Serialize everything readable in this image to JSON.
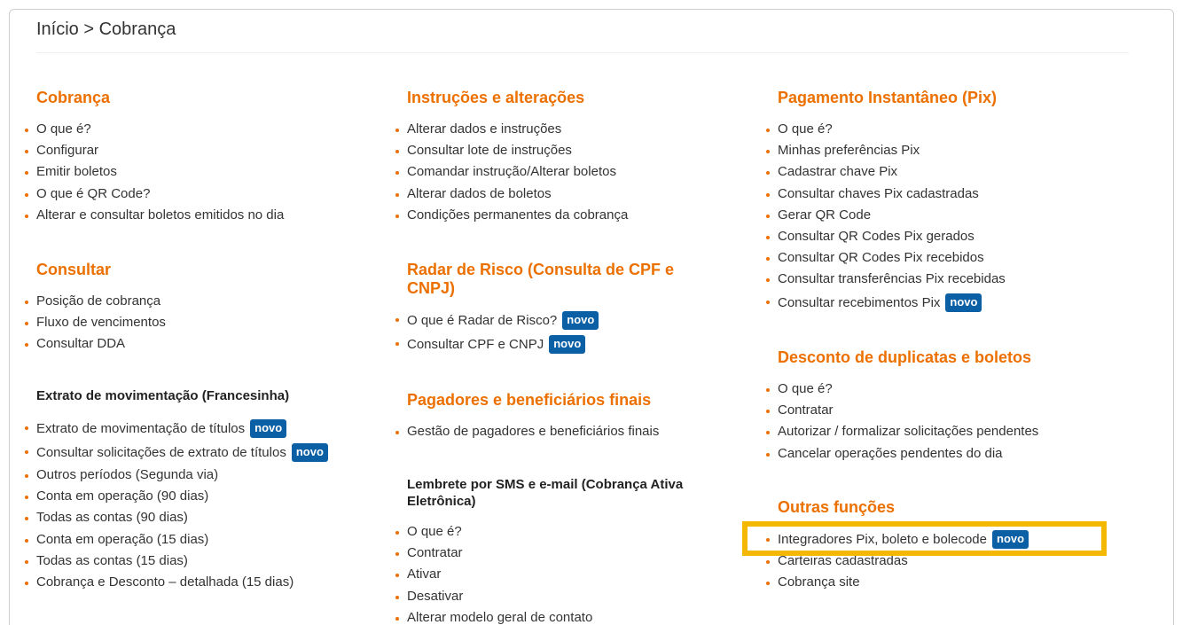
{
  "breadcrumb": "Início > Cobrança",
  "badge_label": "novo",
  "colors": {
    "accent": "#ec7000",
    "badge": "#0b5fa5",
    "highlight": "#f5b800"
  },
  "col1": {
    "cobranca": {
      "title": "Cobrança",
      "items": [
        "O que é?",
        "Configurar",
        "Emitir boletos",
        "O que é QR Code?",
        "Alterar e consultar boletos emitidos no dia"
      ]
    },
    "consultar": {
      "title": "Consultar",
      "items": [
        "Posição de cobrança",
        "Fluxo de vencimentos",
        "Consultar DDA"
      ]
    },
    "extrato": {
      "title": "Extrato de movimentação (Francesinha)",
      "items": [
        "Extrato de movimentação de títulos",
        "Consultar solicitações de extrato de títulos",
        "Outros períodos (Segunda via)",
        "Conta em operação (90 dias)",
        "Todas as contas (90 dias)",
        "Conta em operação (15 dias)",
        "Todas as contas (15 dias)",
        "Cobrança e Desconto – detalhada (15 dias)"
      ]
    }
  },
  "col2": {
    "instrucoes": {
      "title": "Instruções e alterações",
      "items": [
        "Alterar dados e instruções",
        "Consultar lote de instruções",
        "Comandar instrução/Alterar boletos",
        "Alterar dados de boletos",
        "Condições permanentes da cobrança"
      ]
    },
    "radar": {
      "title_line1": "Radar de Risco (Consulta de CPF e",
      "title_line2": "CNPJ)",
      "items": [
        "O que é Radar de Risco?",
        "Consultar CPF e CNPJ"
      ]
    },
    "pagadores": {
      "title": "Pagadores e beneficiários finais",
      "items": [
        "Gestão de pagadores e beneficiários finais"
      ]
    },
    "lembrete": {
      "title_line1": "Lembrete por SMS e e-mail (Cobrança Ativa",
      "title_line2": "Eletrônica)",
      "items": [
        "O que é?",
        "Contratar",
        "Ativar",
        "Desativar",
        "Alterar modelo geral de contato"
      ]
    }
  },
  "col3": {
    "pix": {
      "title": "Pagamento Instantâneo (Pix)",
      "items": [
        "O que é?",
        "Minhas preferências Pix",
        "Cadastrar chave Pix",
        "Consultar chaves Pix cadastradas",
        "Gerar QR Code",
        "Consultar QR Codes Pix gerados",
        "Consultar QR Codes Pix recebidos",
        "Consultar transferências Pix recebidas",
        "Consultar recebimentos Pix"
      ]
    },
    "desconto": {
      "title": "Desconto de duplicatas e boletos",
      "items": [
        "O que é?",
        "Contratar",
        "Autorizar / formalizar solicitações pendentes",
        "Cancelar operações pendentes do dia"
      ]
    },
    "outras": {
      "title": "Outras funções",
      "items": [
        "Integradores Pix, boleto e bolecode",
        "Carteiras cadastradas",
        "Cobrança site"
      ]
    }
  }
}
